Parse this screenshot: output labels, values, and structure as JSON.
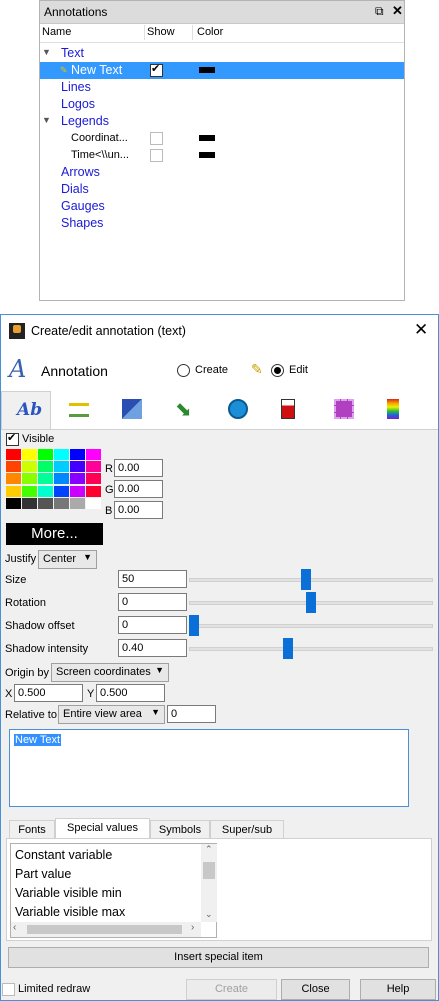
{
  "annotations_panel": {
    "title": "Annotations",
    "columns": [
      "Name",
      "Show",
      "Color"
    ],
    "items": [
      {
        "label": "Text",
        "expanded": true
      },
      {
        "label": "New Text",
        "selected": true,
        "show": true,
        "color": "#000000"
      },
      {
        "label": "Lines"
      },
      {
        "label": "Logos"
      },
      {
        "label": "Legends",
        "expanded": true
      },
      {
        "label": "Coordinat...",
        "show": false,
        "color": "#000000"
      },
      {
        "label": "Time<\\\\un...",
        "show": false,
        "color": "#000000"
      },
      {
        "label": "Arrows"
      },
      {
        "label": "Dials"
      },
      {
        "label": "Gauges"
      },
      {
        "label": "Shapes"
      }
    ]
  },
  "dialog": {
    "title": "Create/edit annotation (text)",
    "heading": "Annotation",
    "mode_create": "Create",
    "mode_edit": "Edit",
    "active_mode": "Edit",
    "tabs": [
      "text-tab",
      "lines-tab",
      "logos-tab",
      "arrows-tab",
      "dials-tab",
      "gauges-tab",
      "shapes-tab",
      "legends-tab"
    ],
    "visible_label": "Visible",
    "visible_checked": true,
    "palette": [
      "#ff0000",
      "#ffff00",
      "#00ff00",
      "#00ffff",
      "#0000ff",
      "#ff00ff",
      "#ff4400",
      "#ccff00",
      "#00ff66",
      "#00ccff",
      "#4400ff",
      "#ff0099",
      "#ff8800",
      "#88ff00",
      "#00ff99",
      "#0088ff",
      "#8800ff",
      "#ff0055",
      "#ffcc00",
      "#44ff00",
      "#00ffcc",
      "#0044ff",
      "#cc00ff",
      "#ff0033",
      "#000000",
      "#333333",
      "#555555",
      "#777777",
      "#aaaaaa",
      "#ffffff"
    ],
    "more_label": "More...",
    "r_label": "R",
    "r_value": "0.00",
    "g_label": "G",
    "g_value": "0.00",
    "b_label": "B",
    "b_value": "0.00",
    "justify_label": "Justify",
    "justify_value": "Center",
    "size_label": "Size",
    "size_value": "50",
    "size_level": 0.48,
    "rotation_label": "Rotation",
    "rotation_value": "0",
    "rotation_level": 0.5,
    "shadow_offset_label": "Shadow offset",
    "shadow_offset_value": "0",
    "shadow_offset_level": 0.0,
    "shadow_intensity_label": "Shadow intensity",
    "shadow_intensity_value": "0.40",
    "shadow_intensity_level": 0.4,
    "origin_label": "Origin by",
    "origin_value": "Screen coordinates",
    "x_label": "X",
    "x_value": "0.500",
    "y_label": "Y",
    "y_value": "0.500",
    "relative_label": "Relative to",
    "relative_value": "Entire view area",
    "relative_index": "0",
    "text_value": "New Text",
    "sub_tabs": [
      "Fonts",
      "Special values",
      "Symbols",
      "Super/sub"
    ],
    "active_sub_tab": "Special values",
    "special_items": [
      "Constant variable",
      "Part value",
      "Variable visible min",
      "Variable visible max"
    ],
    "insert_label": "Insert special item",
    "limited_redraw_label": "Limited redraw",
    "create_label": "Create",
    "close_label": "Close",
    "help_label": "Help"
  }
}
